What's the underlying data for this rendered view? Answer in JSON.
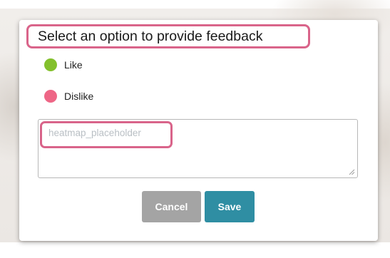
{
  "dialog": {
    "title": "Select an option to provide feedback",
    "options": [
      {
        "label": "Like",
        "color": "#83c02c",
        "icon": "green-dot-icon"
      },
      {
        "label": "Dislike",
        "color": "#ee6686",
        "icon": "pink-dot-icon"
      }
    ],
    "feedback": {
      "value": "",
      "placeholder": "heatmap_placeholder"
    },
    "buttons": {
      "cancel_label": "Cancel",
      "save_label": "Save"
    },
    "highlight_color": "#d9648a"
  }
}
